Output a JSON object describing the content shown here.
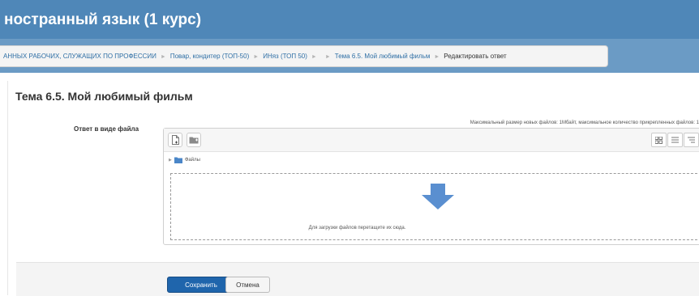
{
  "header": {
    "title": "ностранный язык (1 курс)"
  },
  "breadcrumb": {
    "items": [
      "АННЫХ РАБОЧИХ, СЛУЖАЩИХ ПО ПРОФЕССИИ",
      "Повар, кондитер (ТОП-50)",
      "ИНяз (ТОП 50)",
      "",
      "Тема 6.5. Мой любимый фильм",
      "Редактировать ответ"
    ]
  },
  "main": {
    "title": "Тема 6.5. Мой любимый фильм",
    "field_label": "Ответ в виде файла",
    "file_info": "Максимальный размер новых файлов: 1Мбайт, максимальное количество прикрепленных файлов: 1",
    "filemanager": {
      "path_label": "Файлы",
      "drop_text": "Для загрузки файлов перетащите их сюда."
    }
  },
  "footer": {
    "save_label": "Сохранить",
    "cancel_label": "Отмена"
  },
  "colors": {
    "header_bg": "#4f87b8",
    "band_bg": "#6b9bc5",
    "link": "#2f6fa5",
    "primary_button": "#1f65ac",
    "drop_arrow": "#5a8fd0"
  },
  "icons": {
    "add_file": "add-file-icon",
    "create_folder": "create-folder-icon",
    "view_icons": "grid-view-icon",
    "view_list": "list-view-icon",
    "view_tree": "tree-view-icon",
    "folder": "folder-icon",
    "drop_arrow": "down-arrow-icon"
  }
}
